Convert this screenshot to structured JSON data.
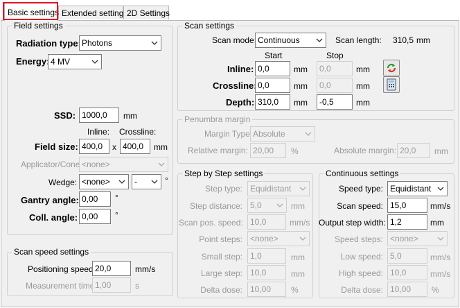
{
  "tabs": [
    "Basic settings",
    "Extended settings",
    "2D Settings"
  ],
  "field": {
    "title": "Field settings",
    "radiation_label": "Radiation type:",
    "radiation_value": "Photons",
    "energy_label": "Energy:",
    "energy_value": "4 MV",
    "ssd_label": "SSD:",
    "ssd_value": "1000,0",
    "ssd_unit": "mm",
    "inline_hdr": "Inline:",
    "crossline_hdr": "Crossline:",
    "fieldsize_label": "Field size:",
    "fieldsize_inline": "400,0",
    "x_sep": "x",
    "fieldsize_crossline": "400,0",
    "fieldsize_unit": "mm",
    "applicator_label": "Applicator/Cone:",
    "applicator_value": "<none>",
    "wedge_label": "Wedge:",
    "wedge_value": "<none>",
    "wedge_dir": "-",
    "wedge_unit": "°",
    "gantry_label": "Gantry angle:",
    "gantry_value": "0,00",
    "gantry_unit": "°",
    "coll_label": "Coll. angle:",
    "coll_value": "0,00",
    "coll_unit": "°"
  },
  "speed": {
    "title": "Scan speed settings",
    "positioning_label": "Positioning speed:",
    "positioning_value": "20,0",
    "positioning_unit": "mm/s",
    "measurement_label": "Measurement time:",
    "measurement_value": "1,00",
    "measurement_unit": "s"
  },
  "scan": {
    "title": "Scan settings",
    "mode_label": "Scan mode:",
    "mode_value": "Continuous",
    "length_label": "Scan length:",
    "length_value": "310,5",
    "length_unit": "mm",
    "start_hdr": "Start",
    "stop_hdr": "Stop",
    "inline_label": "Inline:",
    "inline_start": "0,0",
    "inline_stop": "0,0",
    "crossline_label": "Crossline:",
    "crossline_start": "0,0",
    "crossline_stop": "0,0",
    "depth_label": "Depth:",
    "depth_start": "310,0",
    "depth_stop": "-0,5",
    "unit": "mm"
  },
  "penumbra": {
    "title": "Penumbra margin",
    "type_label": "Margin Type:",
    "type_value": "Absolute",
    "rel_label": "Relative margin:",
    "rel_value": "20,00",
    "rel_unit": "%",
    "abs_label": "Absolute margin:",
    "abs_value": "20,0",
    "abs_unit": "mm"
  },
  "step": {
    "title": "Step by Step settings",
    "type_label": "Step type:",
    "type_value": "Equidistant",
    "dist_label": "Step distance:",
    "dist_value": "5,0",
    "dist_unit": "mm",
    "pos_label": "Scan pos. speed:",
    "pos_value": "10,0",
    "pos_unit": "mm/s",
    "points_label": "Point steps:",
    "points_value": "<none>",
    "small_label": "Small step:",
    "small_value": "1,0",
    "small_unit": "mm",
    "large_label": "Large step:",
    "large_value": "10,0",
    "large_unit": "mm",
    "delta_label": "Delta dose:",
    "delta_value": "10,00",
    "delta_unit": "%"
  },
  "cont": {
    "title": "Continuous settings",
    "type_label": "Speed type:",
    "type_value": "Equidistant",
    "speed_label": "Scan speed:",
    "speed_value": "15,0",
    "speed_unit": "mm/s",
    "out_label": "Output step width:",
    "out_value": "1,2",
    "out_unit": "mm",
    "steps_label": "Speed steps:",
    "steps_value": "<none>",
    "low_label": "Low speed:",
    "low_value": "5,0",
    "low_unit": "mm/s",
    "high_label": "High speed:",
    "high_value": "10,0",
    "high_unit": "mm/s",
    "delta_label": "Delta dose:",
    "delta_value": "10,00",
    "delta_unit": "%"
  },
  "icons": {
    "reset": "reset-arrows-icon",
    "calculator": "calculator-icon"
  },
  "colors": {
    "highlight": "#e0141e",
    "panel": "#f0f0f0",
    "disabled_text": "#9a9a9a"
  }
}
